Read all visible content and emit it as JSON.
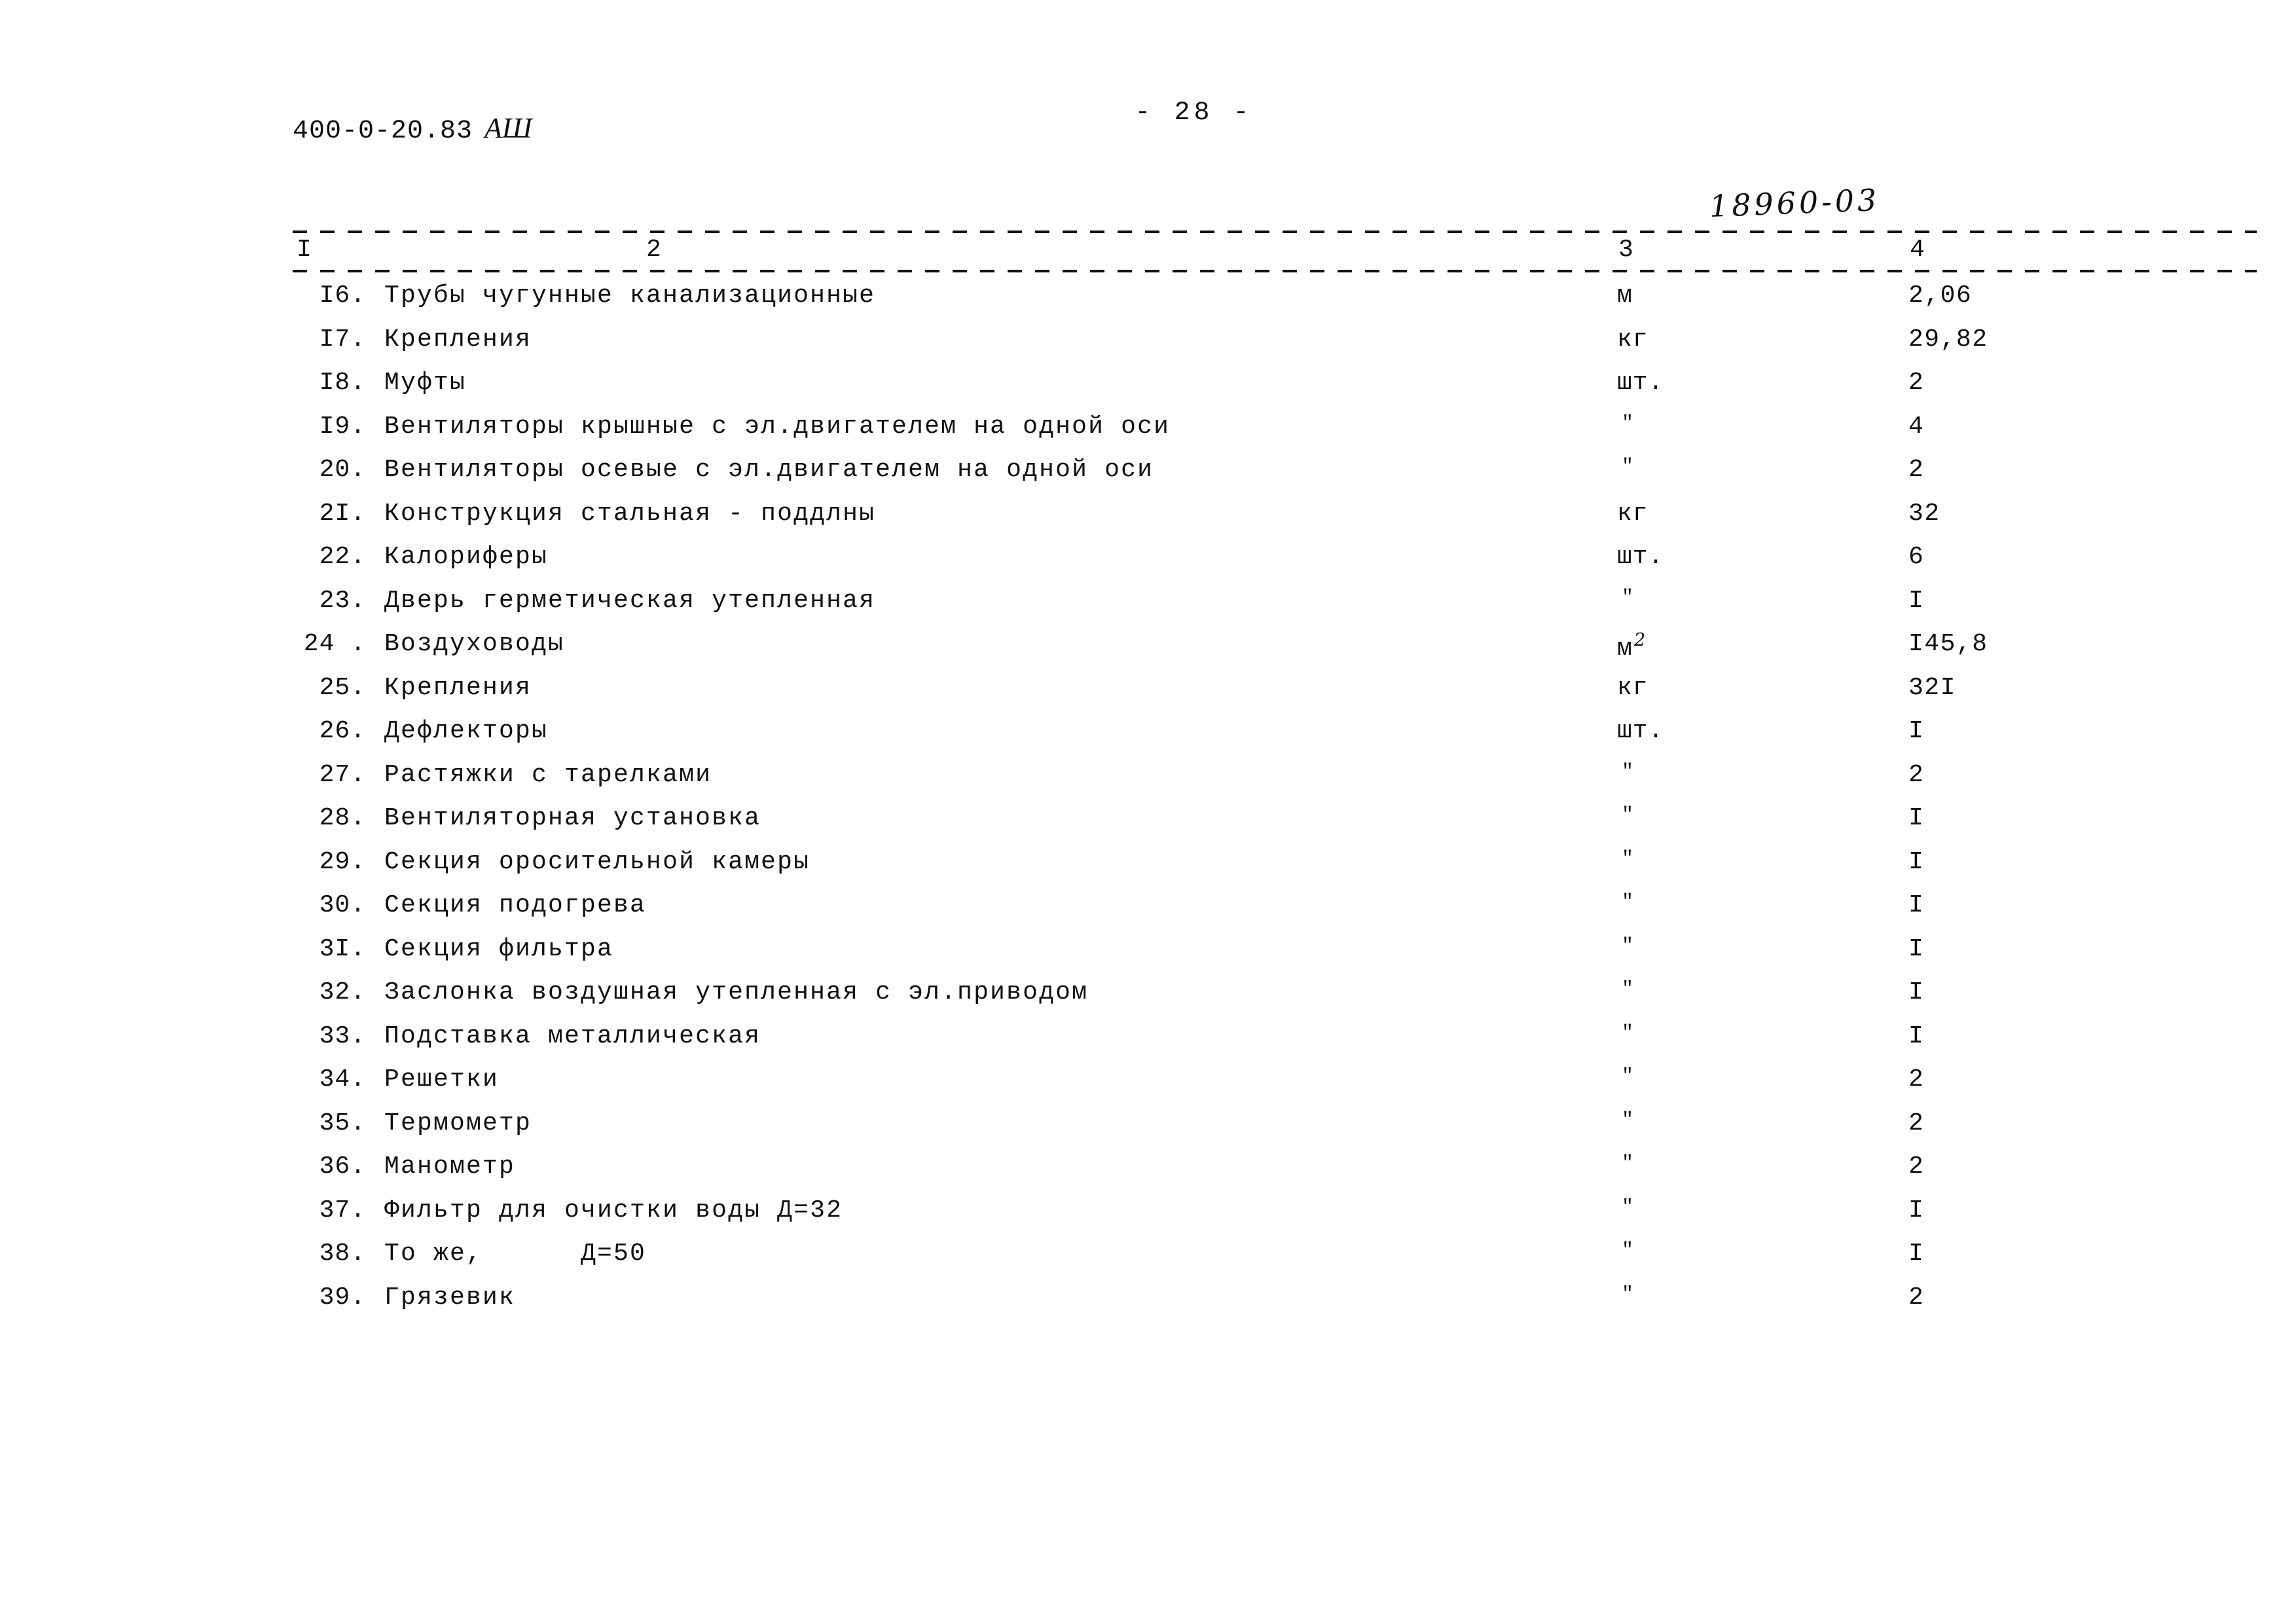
{
  "header": {
    "doc_code": "400-0-20.83",
    "doc_series": "АШ",
    "page_number": "- 28 -"
  },
  "annotation": {
    "handwritten_number": "18960-03"
  },
  "table": {
    "column_headers": [
      "I",
      "2",
      "3",
      "4"
    ],
    "rows": [
      {
        "num": "I6.",
        "name": "Трубы чугунные канализационные",
        "unit": "м",
        "qty": "2,06"
      },
      {
        "num": "I7.",
        "name": "Крепления",
        "unit": "кг",
        "qty": "29,82"
      },
      {
        "num": "I8.",
        "name": "Муфты",
        "unit": "шт.",
        "qty": "2"
      },
      {
        "num": "I9.",
        "name": "Вентиляторы крышные с эл.двигателем на одной оси",
        "unit": "\"",
        "qty": "4"
      },
      {
        "num": "20.",
        "name": "Вентиляторы осевые с эл.двигателем на одной оси",
        "unit": "\"",
        "qty": "2"
      },
      {
        "num": "2I.",
        "name": "Конструкция стальная - поддлны",
        "unit": "кг",
        "qty": "32"
      },
      {
        "num": "22.",
        "name": "Калориферы",
        "unit": "шт.",
        "qty": "6"
      },
      {
        "num": "23.",
        "name": "Дверь герметическая утепленная",
        "unit": "\"",
        "qty": "I"
      },
      {
        "num": "24 .",
        "name": "Воздуховоды",
        "unit": "м",
        "unit_sup": "2",
        "qty": "I45,8"
      },
      {
        "num": "25.",
        "name": "Крепления",
        "unit": "кг",
        "qty": "32I"
      },
      {
        "num": "26.",
        "name": "Дефлекторы",
        "unit": "шт.",
        "qty": "I"
      },
      {
        "num": "27.",
        "name": "Растяжки с тарелками",
        "unit": "\"",
        "qty": "2"
      },
      {
        "num": "28.",
        "name": "Вентиляторная установка",
        "unit": "\"",
        "qty": "I"
      },
      {
        "num": "29.",
        "name": "Секция оросительной камеры",
        "unit": "\"",
        "qty": "I"
      },
      {
        "num": "30.",
        "name": "Секция подогрева",
        "unit": "\"",
        "qty": "I"
      },
      {
        "num": "3I.",
        "name": "Секция фильтра",
        "unit": "\"",
        "qty": "I"
      },
      {
        "num": "32.",
        "name": "Заслонка воздушная утепленная с эл.приводом",
        "unit": "\"",
        "qty": "I"
      },
      {
        "num": "33.",
        "name": "Подставка металлическая",
        "unit": "\"",
        "qty": "I"
      },
      {
        "num": "34.",
        "name": "Решетки",
        "unit": "\"",
        "qty": "2"
      },
      {
        "num": "35.",
        "name": "Термометр",
        "unit": "\"",
        "qty": "2"
      },
      {
        "num": "36.",
        "name": "Манометр",
        "unit": "\"",
        "qty": "2"
      },
      {
        "num": "37.",
        "name": "Фильтр для очистки воды Д=32",
        "unit": "\"",
        "qty": "I"
      },
      {
        "num": "38.",
        "name": "То же,",
        "name_tab": "Д=50",
        "unit": "\"",
        "qty": "I"
      },
      {
        "num": "39.",
        "name": "Грязевик",
        "unit": "\"",
        "qty": "2"
      }
    ]
  }
}
